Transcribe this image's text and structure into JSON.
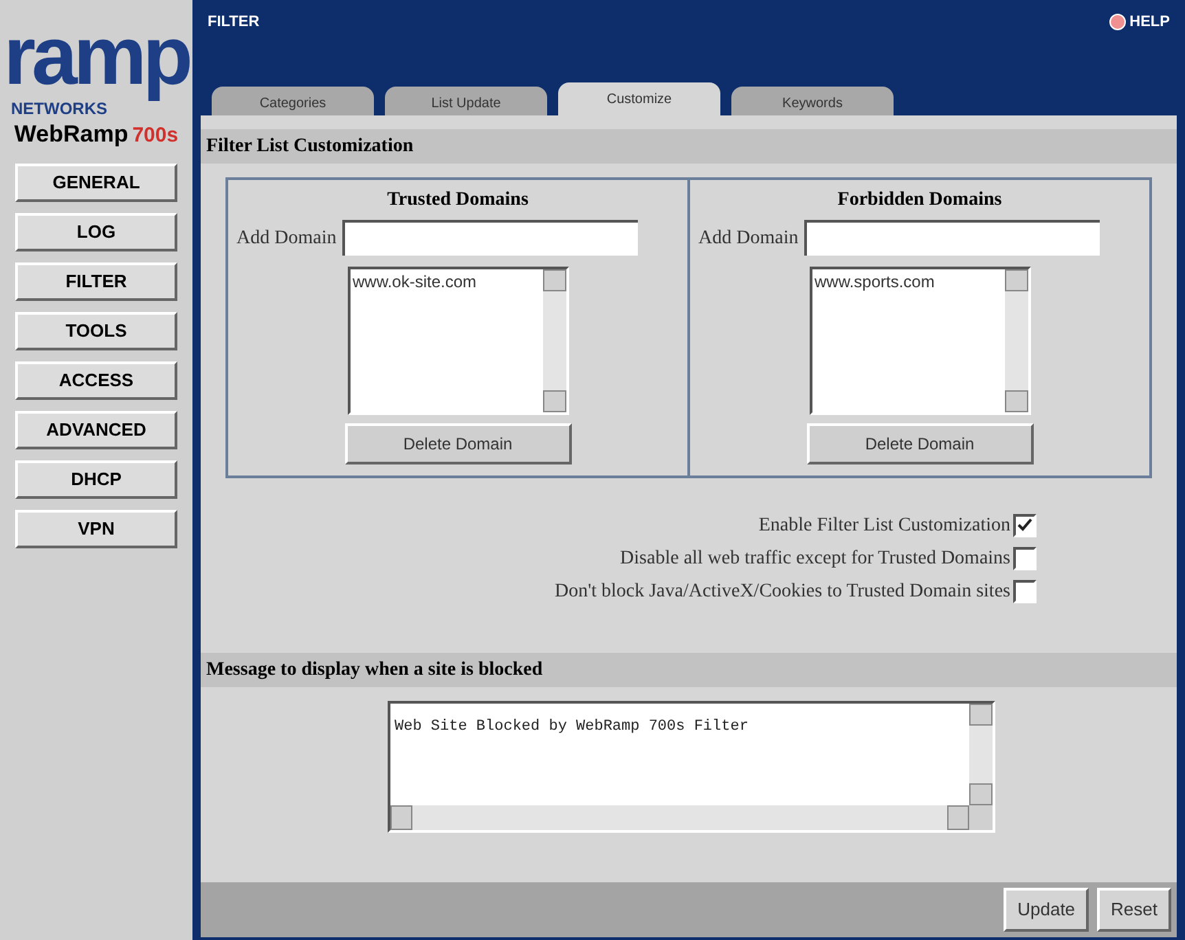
{
  "logo": {
    "word": "ramp",
    "company": "NETWORKS",
    "product": "WebRamp",
    "model": "700s"
  },
  "nav": [
    "GENERAL",
    "LOG",
    "FILTER",
    "TOOLS",
    "ACCESS",
    "ADVANCED",
    "DHCP",
    "VPN"
  ],
  "header": {
    "title": "FILTER",
    "help": "HELP"
  },
  "tabs": [
    {
      "label": "Categories",
      "selected": false
    },
    {
      "label": "List Update",
      "selected": false
    },
    {
      "label": "Customize",
      "selected": true
    },
    {
      "label": "Keywords",
      "selected": false
    }
  ],
  "section_title": "Filter List Customization",
  "lists": [
    {
      "title": "Trusted Domains",
      "add_label": "Add Domain",
      "entries": [
        "www.ok-site.com"
      ],
      "delete": "Delete Domain"
    },
    {
      "title": "Forbidden Domains",
      "add_label": "Add Domain",
      "entries": [
        "www.sports.com"
      ],
      "delete": "Delete Domain"
    }
  ],
  "options": [
    {
      "label": "Enable Filter List Customization",
      "checked": true
    },
    {
      "label": "Disable all web traffic except for Trusted Domains",
      "checked": false
    },
    {
      "label": "Don't block Java/ActiveX/Cookies to Trusted Domain sites",
      "checked": false
    }
  ],
  "message": {
    "title": "Message to display when a site is blocked",
    "value": "Web Site Blocked by WebRamp 700s Filter"
  },
  "buttons": [
    "Update",
    "Reset"
  ]
}
